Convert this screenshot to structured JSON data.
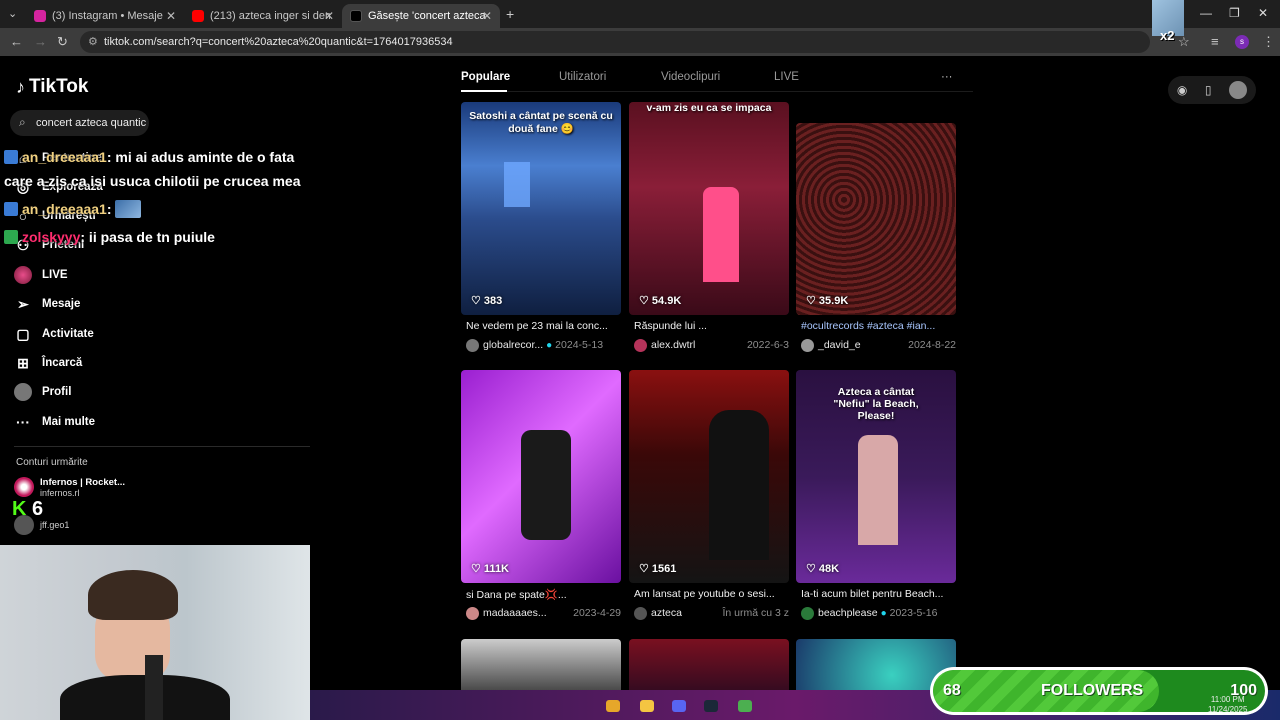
{
  "browser": {
    "tabs": [
      {
        "title": "(3) Instagram • Mesaje",
        "color": "#d6249f"
      },
      {
        "title": "(213) azteca inger si demon aft",
        "color": "#ff0000"
      },
      {
        "title": "Găsește 'concert azteca quantic",
        "color": "#000000"
      }
    ],
    "url": "tiktok.com/search?q=concert%20azteca%20quantic&t=1764017936534"
  },
  "tiktok": {
    "logo": "TikTok",
    "search_value": "concert azteca quantic",
    "nav": [
      {
        "label": "Pentru tine",
        "icon": "home-icon"
      },
      {
        "label": "Explorează",
        "icon": "compass-icon"
      },
      {
        "label": "Urmărești",
        "icon": "following-icon"
      },
      {
        "label": "Prieteni",
        "icon": "friends-icon"
      },
      {
        "label": "LIVE",
        "icon": "live-icon"
      },
      {
        "label": "Mesaje",
        "icon": "messages-icon"
      },
      {
        "label": "Activitate",
        "icon": "activity-icon"
      },
      {
        "label": "Încarcă",
        "icon": "upload-icon"
      },
      {
        "label": "Profil",
        "icon": "profile-icon"
      },
      {
        "label": "Mai multe",
        "icon": "more-icon"
      }
    ],
    "following_heading": "Conturi urmărite",
    "following": [
      {
        "name": "Infernos | Rocket...",
        "handle": "infernos.rl"
      },
      {
        "name": "jff.geo1",
        "handle": ""
      }
    ],
    "tabs": [
      "Populare",
      "Utilizatori",
      "Videoclipuri",
      "LIVE"
    ],
    "more": "···",
    "videos": [
      {
        "likes": "383",
        "caption": "Ne vedem pe 23 mai la conc...",
        "user": "globalrecor...",
        "date": "2024-5-13",
        "overlay": "Satoshi a cântat pe scenă cu două fane 😊"
      },
      {
        "likes": "54.9K",
        "caption": "Răspunde lui ...",
        "user": "alex.dwtrl",
        "date": "2022-6-3",
        "overlay": "v-am zis eu ca se impaca"
      },
      {
        "likes": "35.9K",
        "caption": "#ocultrecords #azteca #ian...",
        "user": "_david_e",
        "date": "2024-8-22",
        "overlay": ""
      },
      {
        "likes": "111K",
        "caption": "si Dana pe spate💢...",
        "user": "madaaaaes...",
        "date": "2023-4-29",
        "overlay": ""
      },
      {
        "likes": "1561",
        "caption": "Am lansat pe youtube o sesi...",
        "user": "azteca",
        "date": "În urmă cu 3 z",
        "overlay": ""
      },
      {
        "likes": "48K",
        "caption": "Ia-ti acum bilet pentru Beach...",
        "user": "beachplease",
        "date": "2023-5-16",
        "overlay": "Azteca a cântat \"Nefiu\" la Beach, Please!"
      }
    ]
  },
  "chat": [
    {
      "user": "an_dreeaaa1",
      "text": ": mi ai adus aminte de o fata"
    },
    {
      "user": "",
      "text": "care a zis ca isi usuca chilotii pe crucea mea"
    },
    {
      "user": "an_dreeaaa1",
      "text": ":"
    },
    {
      "user": "zolskyyy",
      "text": ": ii pasa de tn puiule"
    }
  ],
  "stream": {
    "k_badge": "K 6",
    "x2": "x2",
    "followers_current": "68",
    "followers_label": "FOLLOWERS",
    "followers_goal": "100",
    "followers_progress": 0.68,
    "clock_time": "11:00 PM",
    "clock_date": "11/24/2025"
  }
}
